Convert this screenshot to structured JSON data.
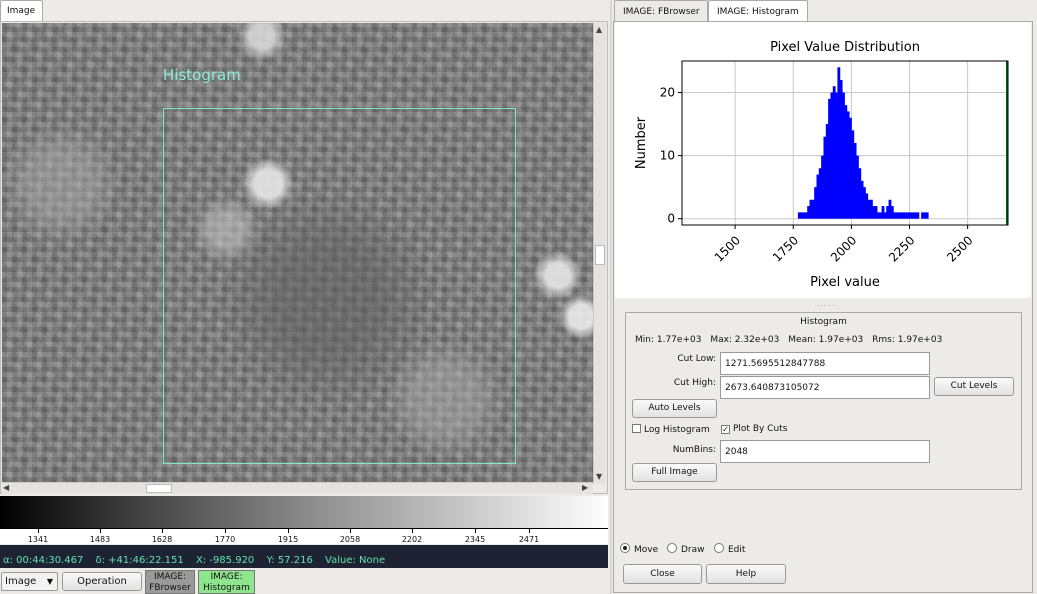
{
  "left": {
    "tab_label": "Image",
    "overlay_label": "Histogram",
    "colorbar_ticks": [
      "1341",
      "1483",
      "1628",
      "1770",
      "1915",
      "2058",
      "2202",
      "2345",
      "2471"
    ],
    "status": {
      "ra": "α: 00:44:30.467",
      "dec": "δ: +41:46:22.151",
      "x": "X: -985.920",
      "y": "Y: 57.216",
      "value": "Value: None"
    },
    "bottom": {
      "combo_value": "Image",
      "operation_label": "Operation",
      "ws_tab1_line1": "IMAGE:",
      "ws_tab1_line2": "FBrowser",
      "ws_tab2_line1": "IMAGE:",
      "ws_tab2_line2": "Histogram"
    },
    "colors": {
      "overlay": "#7fe8c8",
      "status_bg": "#1d2333",
      "status_text": "#62e0b0",
      "ws_active": "#8ee58e"
    }
  },
  "right": {
    "tabs": [
      "IMAGE: FBrowser",
      "IMAGE: Histogram"
    ],
    "group_title": "Histogram",
    "stats": {
      "min": "Min:  1.77e+03",
      "max": "Max:  2.32e+03",
      "mean": "Mean:  1.97e+03",
      "rms": "Rms:  1.97e+03"
    },
    "cut_low_label": "Cut Low:",
    "cut_low_value": "1271.5695512847788",
    "cut_high_label": "Cut High:",
    "cut_high_value": "2673.640873105072",
    "cut_levels_button": "Cut Levels",
    "auto_levels_button": "Auto Levels",
    "log_histogram_label": "Log Histogram",
    "log_histogram_checked": false,
    "plot_by_cuts_label": "Plot By Cuts",
    "plot_by_cuts_checked": true,
    "numbins_label": "NumBins:",
    "numbins_value": "2048",
    "full_image_button": "Full Image",
    "modes": [
      "Move",
      "Draw",
      "Edit"
    ],
    "mode_selected": "Move",
    "close_button": "Close",
    "help_button": "Help"
  },
  "chart_data": {
    "type": "bar",
    "title": "Pixel Value Distribution",
    "xlabel": "Pixel value",
    "ylabel": "Number",
    "xlim": [
      1271.57,
      2673.64
    ],
    "ylim": [
      -1,
      25
    ],
    "xticks": [
      1500,
      1750,
      2000,
      2250,
      2500
    ],
    "yticks": [
      0,
      10,
      20
    ],
    "grid": true,
    "bar_color": "#0000ff",
    "cut_line_color": "#006400",
    "x": [
      1770,
      1780,
      1790,
      1800,
      1810,
      1820,
      1830,
      1840,
      1850,
      1860,
      1870,
      1880,
      1890,
      1900,
      1910,
      1920,
      1930,
      1940,
      1950,
      1960,
      1970,
      1980,
      1990,
      2000,
      2010,
      2020,
      2030,
      2040,
      2050,
      2060,
      2070,
      2080,
      2090,
      2100,
      2110,
      2120,
      2130,
      2140,
      2150,
      2160,
      2170,
      2180,
      2190,
      2200,
      2210,
      2220,
      2230,
      2240,
      2250,
      2260,
      2270,
      2280,
      2290,
      2300,
      2310,
      2320
    ],
    "values": [
      1,
      1,
      1,
      1,
      2,
      3,
      3,
      5,
      7,
      8,
      10,
      13,
      15,
      19,
      20,
      21,
      20,
      24,
      22,
      20,
      18,
      17,
      16,
      14,
      12,
      10,
      8,
      6,
      5,
      4,
      3,
      3,
      2,
      2,
      1,
      1,
      2,
      1,
      2,
      3,
      2,
      1,
      1,
      1,
      1,
      1,
      1,
      1,
      1,
      1,
      1,
      1,
      0,
      1,
      1,
      1
    ]
  }
}
